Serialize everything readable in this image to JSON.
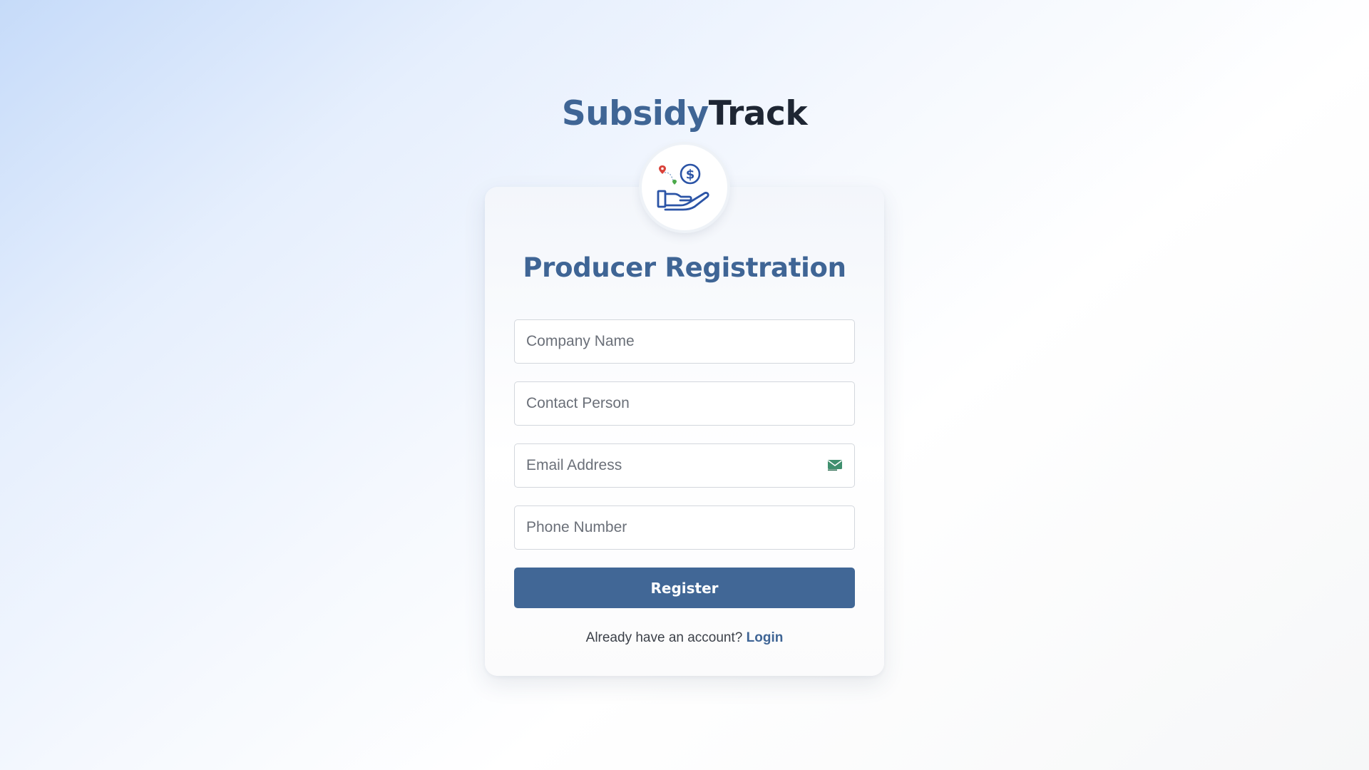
{
  "brand": {
    "part1": "Subsidy",
    "part2": "Track",
    "logo_icon": "hand-holding-dollar-icon"
  },
  "form": {
    "title": "Producer Registration",
    "fields": [
      {
        "name": "company-name",
        "placeholder": "Company Name",
        "value": ""
      },
      {
        "name": "contact-person",
        "placeholder": "Contact Person",
        "value": ""
      },
      {
        "name": "email-address",
        "placeholder": "Email Address",
        "value": "",
        "icon": "email-icon"
      },
      {
        "name": "phone-number",
        "placeholder": "Phone Number",
        "value": ""
      }
    ],
    "submit_label": "Register",
    "login_prompt": "Already have an account?",
    "login_link": "Login"
  },
  "colors": {
    "brand_primary": "#3f6595",
    "brand_dark": "#1e2633",
    "button": "#416796"
  }
}
